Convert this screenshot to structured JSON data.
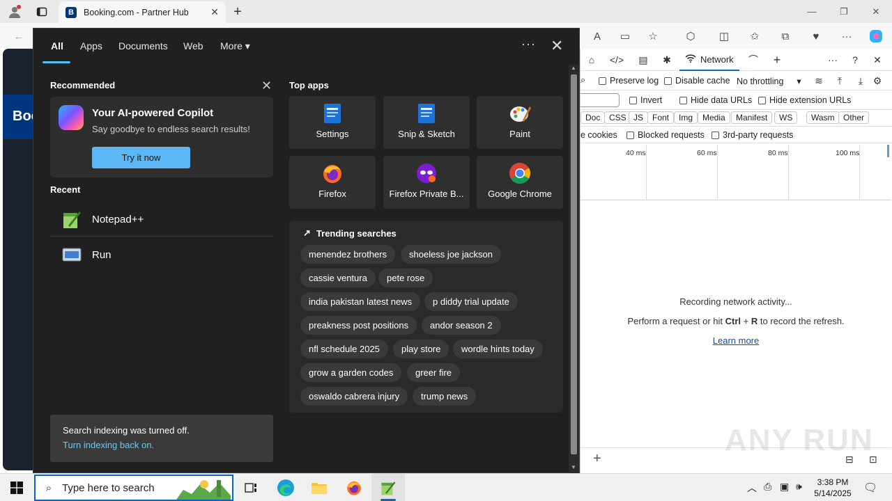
{
  "browser": {
    "tab_title": "Booking.com - Partner Hub",
    "tab_favicon_letter": "B",
    "page_fragment": "Boo"
  },
  "devtools": {
    "network_tab_label": "Network",
    "preserve_log": "Preserve log",
    "disable_cache": "Disable cache",
    "throttling": "No throttling",
    "invert": "Invert",
    "hide_data_urls": "Hide data URLs",
    "hide_extension_urls": "Hide extension URLs",
    "types": [
      "Doc",
      "CSS",
      "JS",
      "Font",
      "Img",
      "Media",
      "Manifest",
      "WS",
      "Wasm",
      "Other"
    ],
    "cookies_fragment": "e cookies",
    "blocked_requests": "Blocked requests",
    "third_party": "3rd-party requests",
    "timeline_labels": [
      "40 ms",
      "60 ms",
      "80 ms",
      "100 ms"
    ],
    "recording": "Recording network activity...",
    "perform_prefix": "Perform a request or hit ",
    "ctrl": "Ctrl",
    "plus": " + ",
    "r_key": "R",
    "perform_suffix": " to record the refresh.",
    "learn_more": "Learn more"
  },
  "search_panel": {
    "tabs": [
      "All",
      "Apps",
      "Documents",
      "Web",
      "More"
    ],
    "more_dots": "···",
    "recommended_heading": "Recommended",
    "copilot": {
      "title": "Your AI-powered Copilot",
      "subtitle": "Say goodbye to endless search results!",
      "button": "Try it now"
    },
    "recent_heading": "Recent",
    "recent": [
      {
        "label": "Notepad++",
        "icon": "notepadpp-icon"
      },
      {
        "label": "Run",
        "icon": "run-icon"
      }
    ],
    "index_notice": "Search indexing was turned off.",
    "index_link": "Turn indexing back on.",
    "top_apps_heading": "Top apps",
    "top_apps": [
      {
        "label": "Settings",
        "icon": "settings-app-icon"
      },
      {
        "label": "Snip & Sketch",
        "icon": "snip-sketch-icon"
      },
      {
        "label": "Paint",
        "icon": "paint-icon"
      },
      {
        "label": "Firefox",
        "icon": "firefox-icon"
      },
      {
        "label": "Firefox Private B...",
        "icon": "firefox-private-icon"
      },
      {
        "label": "Google Chrome",
        "icon": "chrome-icon"
      }
    ],
    "trending_heading": "Trending searches",
    "trending": [
      "menendez brothers",
      "shoeless joe jackson",
      "cassie ventura",
      "pete rose",
      "india pakistan latest news",
      "p diddy trial update",
      "preakness post positions",
      "andor season 2",
      "nfl schedule 2025",
      "play store",
      "wordle hints today",
      "grow a garden codes",
      "greer fire",
      "oswaldo cabrera injury",
      "trump news"
    ]
  },
  "taskbar": {
    "search_placeholder": "Type here to search",
    "time": "3:38 PM",
    "date": "5/14/2025"
  },
  "watermark": "ANY RUN"
}
